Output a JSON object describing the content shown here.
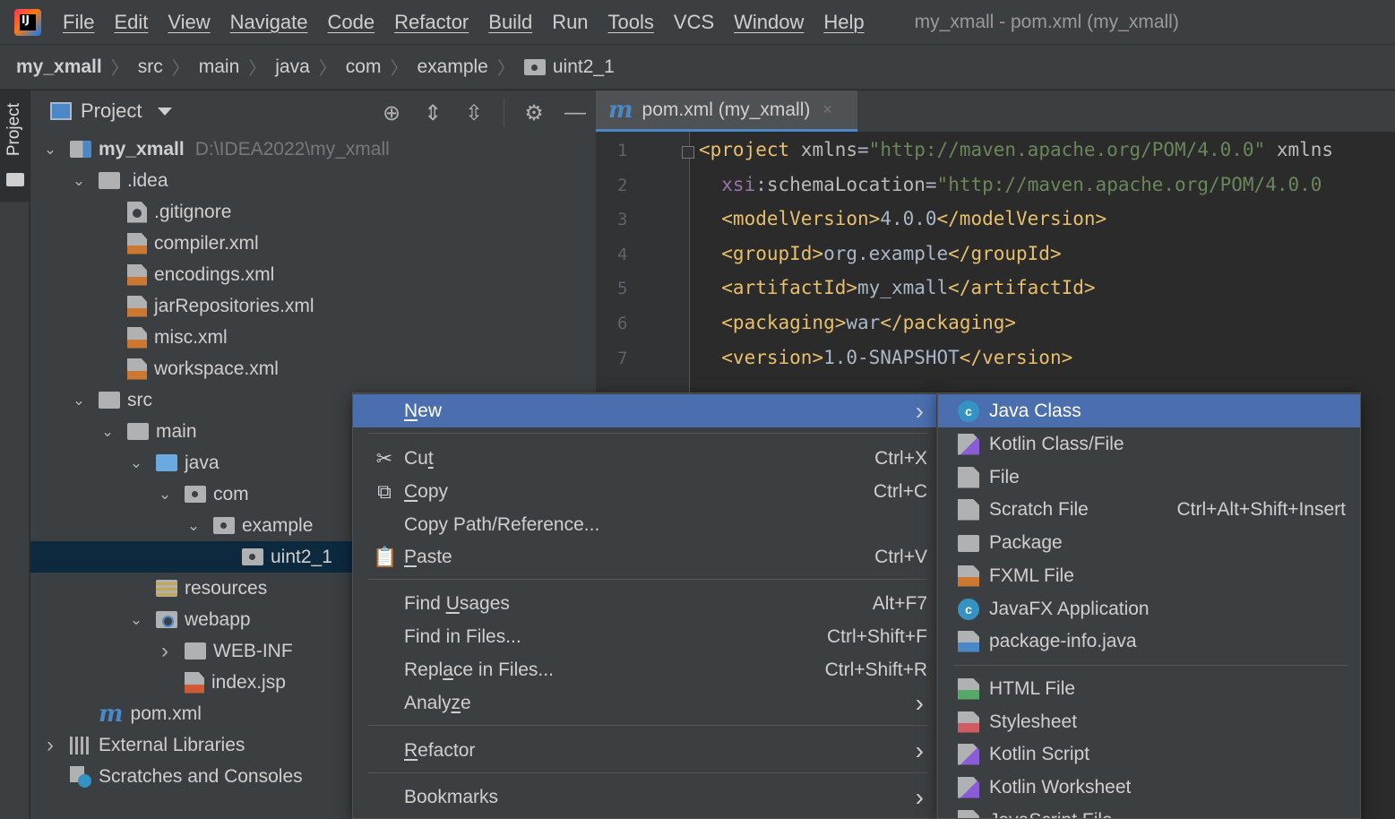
{
  "app": {
    "logo_text": "IJ",
    "menu": [
      "File",
      "Edit",
      "View",
      "Navigate",
      "Code",
      "Refactor",
      "Build",
      "Run",
      "Tools",
      "VCS",
      "Window",
      "Help"
    ],
    "window_title": "my_xmall - pom.xml (my_xmall)"
  },
  "breadcrumb": [
    "my_xmall",
    "src",
    "main",
    "java",
    "com",
    "example",
    "uint2_1"
  ],
  "side_strip": {
    "tab_label": "Project"
  },
  "project_panel": {
    "title": "Project",
    "tree": [
      {
        "label": "my_xmall",
        "path": "D:\\IDEA2022\\my_xmall",
        "depth": 0,
        "expanded": true,
        "icon": "module-folder-icon"
      },
      {
        "label": ".idea",
        "depth": 1,
        "expanded": true,
        "icon": "folder-icon"
      },
      {
        "label": ".gitignore",
        "depth": 2,
        "icon": "gitignore-file-icon"
      },
      {
        "label": "compiler.xml",
        "depth": 2,
        "icon": "xml-file-icon"
      },
      {
        "label": "encodings.xml",
        "depth": 2,
        "icon": "xml-file-icon"
      },
      {
        "label": "jarRepositories.xml",
        "depth": 2,
        "icon": "xml-file-icon"
      },
      {
        "label": "misc.xml",
        "depth": 2,
        "icon": "xml-file-icon"
      },
      {
        "label": "workspace.xml",
        "depth": 2,
        "icon": "xml-file-icon"
      },
      {
        "label": "src",
        "depth": 1,
        "expanded": true,
        "icon": "folder-icon"
      },
      {
        "label": "main",
        "depth": 2,
        "expanded": true,
        "icon": "folder-icon"
      },
      {
        "label": "java",
        "depth": 3,
        "expanded": true,
        "icon": "source-folder-icon"
      },
      {
        "label": "com",
        "depth": 4,
        "expanded": true,
        "icon": "package-icon"
      },
      {
        "label": "example",
        "depth": 5,
        "expanded": true,
        "icon": "package-icon"
      },
      {
        "label": "uint2_1",
        "depth": 6,
        "icon": "package-icon",
        "selected": true
      },
      {
        "label": "resources",
        "depth": 3,
        "icon": "resources-folder-icon"
      },
      {
        "label": "webapp",
        "depth": 3,
        "expanded": true,
        "icon": "web-folder-icon"
      },
      {
        "label": "WEB-INF",
        "depth": 4,
        "expanded": false,
        "icon": "folder-icon"
      },
      {
        "label": "index.jsp",
        "depth": 4,
        "icon": "jsp-file-icon"
      },
      {
        "label": "pom.xml",
        "depth": 1,
        "icon": "maven-icon"
      },
      {
        "label": "External Libraries",
        "depth": 0,
        "expanded": false,
        "icon": "libraries-icon"
      },
      {
        "label": "Scratches and Consoles",
        "depth": 0,
        "icon": "scratches-icon"
      }
    ]
  },
  "editor": {
    "tab_label": "pom.xml (my_xmall)",
    "tab_close": "×",
    "line_numbers": [
      "1",
      "2",
      "3",
      "4",
      "5",
      "6",
      "7"
    ],
    "lines": [
      [
        [
          "tag",
          "<project "
        ],
        [
          "attr",
          "xmlns"
        ],
        [
          "plain",
          "="
        ],
        [
          "str",
          "\"http://maven.apache.org/POM/4.0.0\""
        ],
        [
          "attr",
          " xmlns"
        ]
      ],
      [
        [
          "ns",
          "  xsi"
        ],
        [
          "plain",
          ":"
        ],
        [
          "attr",
          "schemaLocation"
        ],
        [
          "plain",
          "="
        ],
        [
          "str",
          "\"http://maven.apache.org/POM/4.0.0"
        ]
      ],
      [
        [
          "tag",
          "  <modelVersion>"
        ],
        [
          "plain",
          "4.0.0"
        ],
        [
          "tag",
          "</modelVersion>"
        ]
      ],
      [
        [
          "tag",
          "  <groupId>"
        ],
        [
          "plain",
          "org.example"
        ],
        [
          "tag",
          "</groupId>"
        ]
      ],
      [
        [
          "tag",
          "  <artifactId>"
        ],
        [
          "plain",
          "my_xmall"
        ],
        [
          "tag",
          "</artifactId>"
        ]
      ],
      [
        [
          "tag",
          "  <packaging>"
        ],
        [
          "plain",
          "war"
        ],
        [
          "tag",
          "</packaging>"
        ]
      ],
      [
        [
          "tag",
          "  <version>"
        ],
        [
          "plain",
          "1.0-SNAPSHOT"
        ],
        [
          "tag",
          "</version>"
        ]
      ]
    ]
  },
  "context_menu": {
    "items": [
      {
        "label": "New",
        "mnemonic": 0,
        "submenu": true,
        "highlighted": true
      },
      {
        "separator": true
      },
      {
        "label": "Cut",
        "mnemonic": 2,
        "shortcut": "Ctrl+X",
        "icon": "scissors-icon",
        "glyph": "✂"
      },
      {
        "label": "Copy",
        "mnemonic": 0,
        "shortcut": "Ctrl+C",
        "icon": "copy-icon",
        "glyph": "⧉"
      },
      {
        "label": "Copy Path/Reference...",
        "shortcut": ""
      },
      {
        "label": "Paste",
        "mnemonic": 0,
        "shortcut": "Ctrl+V",
        "icon": "paste-icon",
        "glyph": "📋"
      },
      {
        "separator": true
      },
      {
        "label": "Find Usages",
        "mnemonic": 5,
        "shortcut": "Alt+F7"
      },
      {
        "label": "Find in Files...",
        "shortcut": "Ctrl+Shift+F"
      },
      {
        "label": "Replace in Files...",
        "mnemonic": 4,
        "shortcut": "Ctrl+Shift+R"
      },
      {
        "label": "Analyze",
        "mnemonic": 5,
        "submenu": true
      },
      {
        "separator": true
      },
      {
        "label": "Refactor",
        "mnemonic": 0,
        "submenu": true
      },
      {
        "separator": true
      },
      {
        "label": "Bookmarks",
        "submenu": true
      }
    ]
  },
  "new_submenu": {
    "items": [
      {
        "label": "Java Class",
        "icon": "java-class-icon",
        "highlighted": true
      },
      {
        "label": "Kotlin Class/File",
        "icon": "kotlin-file-icon"
      },
      {
        "label": "File",
        "icon": "file-icon"
      },
      {
        "label": "Scratch File",
        "icon": "scratch-file-icon",
        "shortcut": "Ctrl+Alt+Shift+Insert"
      },
      {
        "label": "Package",
        "icon": "package-icon"
      },
      {
        "label": "FXML File",
        "icon": "fxml-file-icon"
      },
      {
        "label": "JavaFX Application",
        "icon": "javafx-class-icon"
      },
      {
        "label": "package-info.java",
        "icon": "package-info-icon"
      },
      {
        "separator": true
      },
      {
        "label": "HTML File",
        "icon": "html-file-icon"
      },
      {
        "label": "Stylesheet",
        "icon": "css-file-icon"
      },
      {
        "label": "Kotlin Script",
        "icon": "kotlin-script-icon"
      },
      {
        "label": "Kotlin Worksheet",
        "icon": "kotlin-worksheet-icon"
      },
      {
        "label": "JavaScript File",
        "icon": "javascript-file-icon"
      }
    ]
  }
}
